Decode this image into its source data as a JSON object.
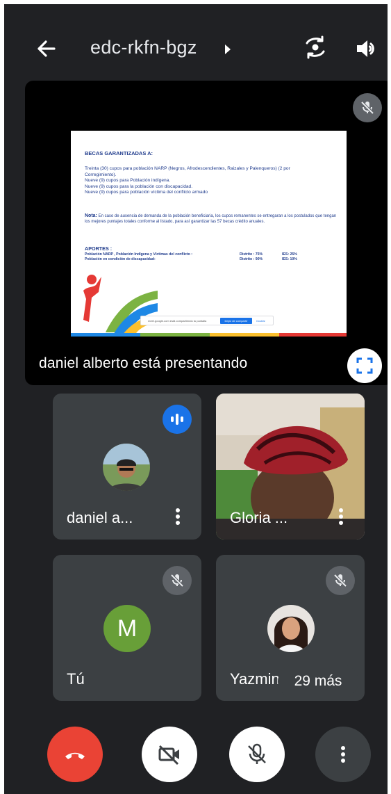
{
  "header": {
    "meeting_code": "edc-rkfn-bgz",
    "icons": [
      "back-arrow-icon",
      "caret-right-icon",
      "switch-camera-icon",
      "speaker-icon"
    ]
  },
  "presentation": {
    "label": "daniel alberto está presentando",
    "slide": {
      "title": "BECAS GARANTIZADAS A:",
      "lines": [
        "Treinta (30) cupos para población NARP (Negros, Afrodescendientes, Raizales y Palenqueros) (2 por",
        "Corregimiento).",
        "Nueve (9) cupos para Población indígena.",
        "Nueve (9) cupos para la población con discapacidad.",
        "Nueve (9) cupos para población víctima del conflicto armado"
      ],
      "note_label": "Nota:",
      "note_text": "En caso de ausencia de demanda de la población beneficiaria, los cupos remanentes se entregaran a los postulados que tengan los mejores puntajes totales conforme al listado, para así garantizar las 57 becas crédito anuales.",
      "aportes_title": "APORTES :",
      "aportes_rows": [
        {
          "group": "Población NARP , Población Indígena y Víctimas del conflicto :",
          "distrito": "Distrito : 75%",
          "ies": "IES: 25%"
        },
        {
          "group": "Población en condición de discapacidad:",
          "distrito": "Distrito : 90%",
          "ies": "IES: 10%"
        }
      ],
      "share_bar": {
        "message": "meet.google.com está compartiendo tu pantalla",
        "stop_label": "Dejar de compartir",
        "hide_label": "Ocultar"
      }
    }
  },
  "participants": [
    {
      "name": "daniel a...",
      "state": "speaking"
    },
    {
      "name": "Gloria ...",
      "state": "video"
    },
    {
      "name": "Tú",
      "initial": "M",
      "state": "muted",
      "avatar_color": "#689f38"
    },
    {
      "name": "Yazmin",
      "state": "muted"
    }
  ],
  "overflow": {
    "label": "29 más"
  },
  "controls": {
    "end_call_color": "#ea4335",
    "buttons": [
      "end-call",
      "camera-off",
      "mic-off",
      "more-options"
    ]
  },
  "colors": {
    "background": "#202124",
    "tile": "#3c4043",
    "accent_blue": "#1a73e8",
    "muted_badge": "#5f6368"
  }
}
